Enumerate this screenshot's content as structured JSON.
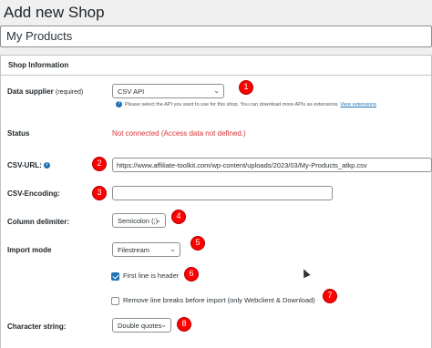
{
  "header": {
    "title": "Add new Shop"
  },
  "shop_name": {
    "value": "My Products"
  },
  "box": {
    "title": "Shop Information"
  },
  "fields": {
    "data_supplier": {
      "label": "Data supplier",
      "required": "(required)",
      "value": "CSV API",
      "hint": "Please select the API you want to use for this shop. You can download more APIs as extensions.",
      "hint_link": "View extensions"
    },
    "status": {
      "label": "Status",
      "value": "Not connected (Access data not defined.)"
    },
    "csv_url": {
      "label": "CSV-URL:",
      "value": "https://www.affiliate-toolkit.com/wp-content/uploads/2023/03/My-Products_atkp.csv"
    },
    "csv_encoding": {
      "label": "CSV-Encoding:",
      "value": ""
    },
    "column_delimiter": {
      "label": "Column delimiter:",
      "value": "Semicolon (;)"
    },
    "import_mode": {
      "label": "Import mode",
      "value": "Filestream"
    },
    "first_line_header": {
      "label": "First line is header",
      "checked": true
    },
    "remove_line_breaks": {
      "label": "Remove line breaks before import (only Webclient & Download)",
      "checked": false
    },
    "character_string": {
      "label": "Character string:",
      "value": "Double quotes"
    }
  },
  "badges": [
    "1",
    "2",
    "3",
    "4",
    "5",
    "6",
    "7",
    "8"
  ],
  "colors": {
    "badge": "#ff0000",
    "status_error": "#d63638",
    "link": "#2271b1"
  }
}
